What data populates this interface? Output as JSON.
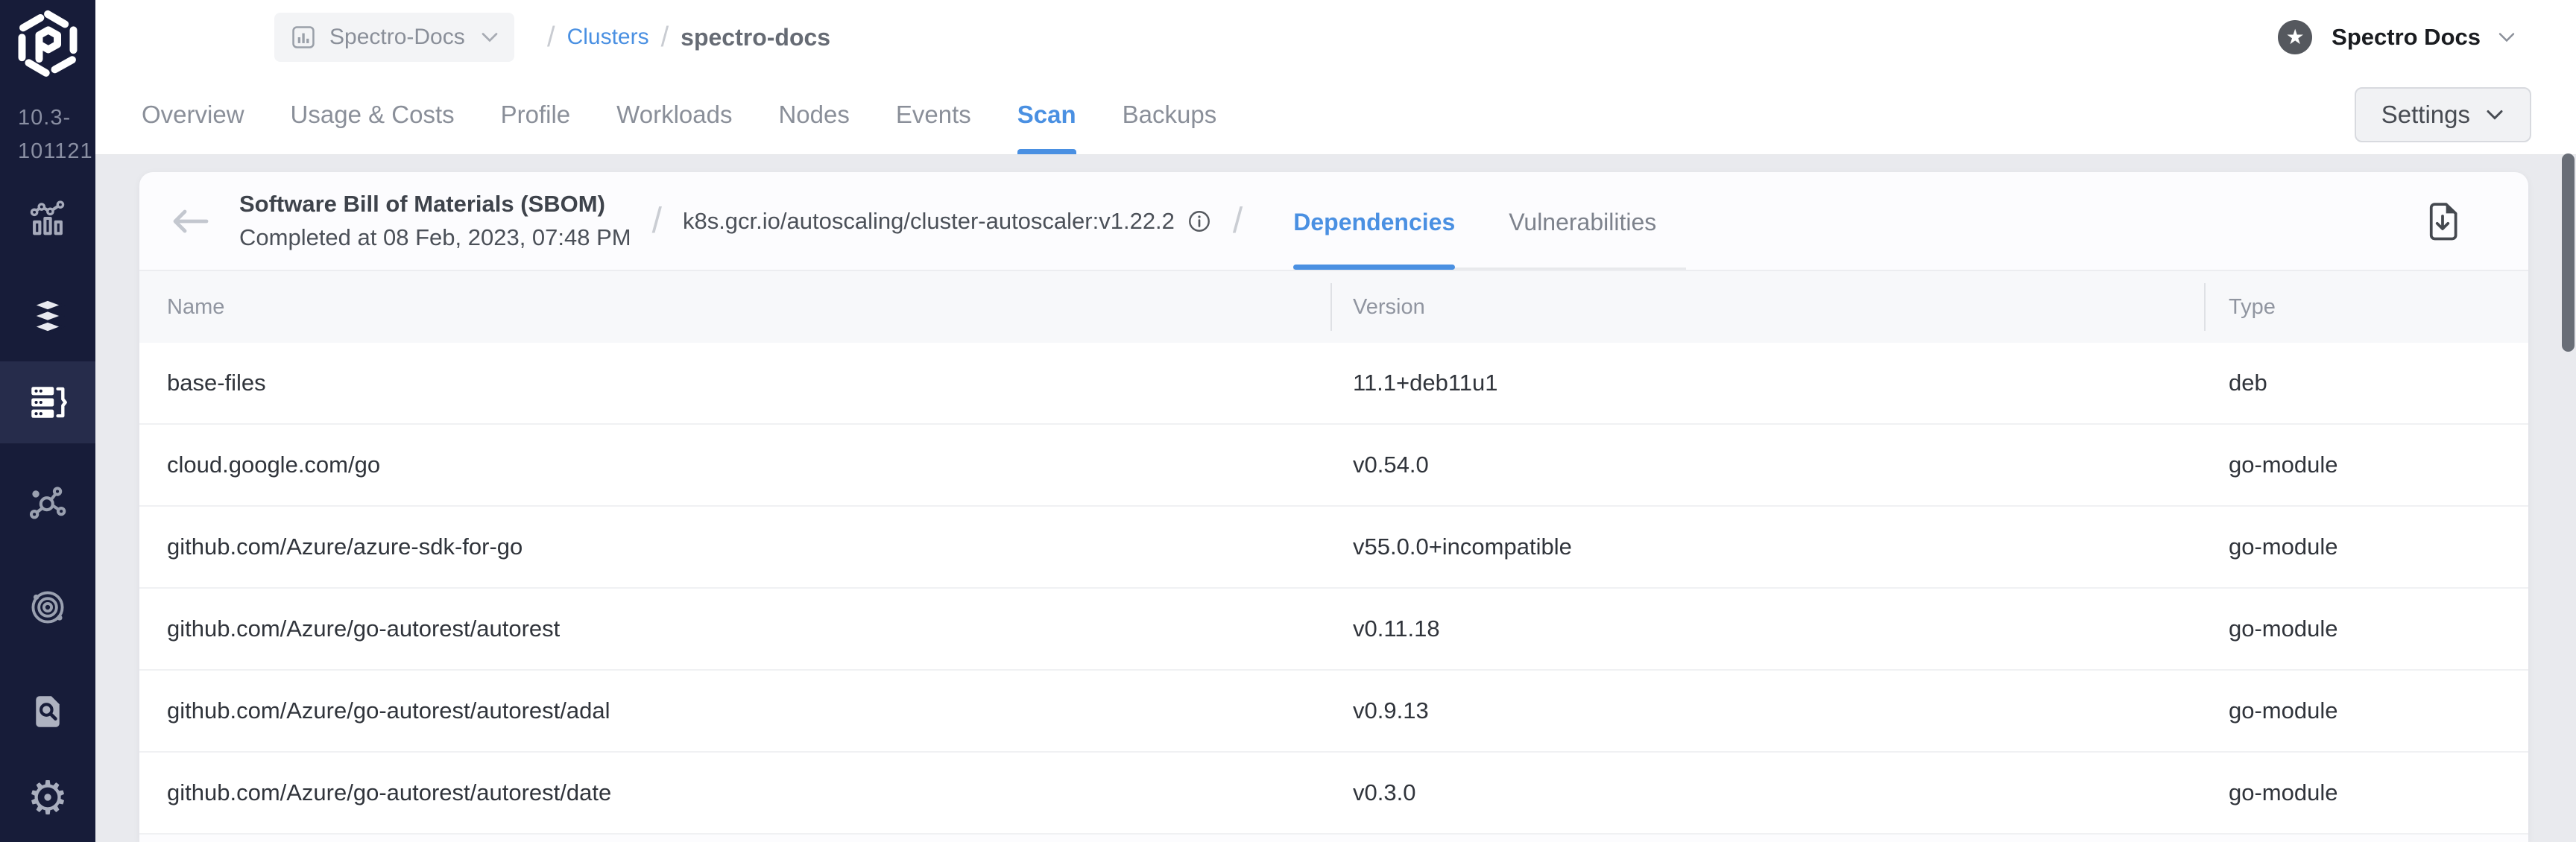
{
  "colors": {
    "accent_blue": "#4A90E2",
    "sidebar_bg": "#171C39",
    "sidebar_active_bg": "#262C4B",
    "content_bg": "#E9EAEE",
    "card_bg": "#FCFCFE",
    "table_header_bg": "#F7F8FA"
  },
  "sidebar": {
    "logo": "palette-logo",
    "version_line1": "10.3-",
    "version_line2": "101121",
    "items": [
      {
        "name": "monitoring",
        "icon": "chart-pulse-icon",
        "active": false
      },
      {
        "name": "profiles",
        "icon": "stacked-layers-icon",
        "active": false
      },
      {
        "name": "clusters",
        "icon": "server-list-icon",
        "active": true
      },
      {
        "name": "workspaces",
        "icon": "network-nodes-icon",
        "active": false
      },
      {
        "name": "registries",
        "icon": "orbit-icon",
        "active": false
      },
      {
        "name": "audit-logs",
        "icon": "document-search-icon",
        "active": false
      },
      {
        "name": "settings",
        "icon": "gear-icon",
        "active": false
      }
    ]
  },
  "topbar": {
    "project_selector": {
      "label": "Spectro-Docs",
      "icon": "bar-chart-icon",
      "chevron": "chevron-down-icon"
    },
    "breadcrumb": {
      "separator": "/",
      "link": "Clusters",
      "current": "spectro-docs"
    },
    "user_menu": {
      "label": "Spectro Docs",
      "avatar_icon": "star-icon",
      "chevron": "chevron-down-icon"
    }
  },
  "tabs": {
    "active": "Scan",
    "items": [
      {
        "label": "Overview"
      },
      {
        "label": "Usage & Costs"
      },
      {
        "label": "Profile"
      },
      {
        "label": "Workloads"
      },
      {
        "label": "Nodes"
      },
      {
        "label": "Events"
      },
      {
        "label": "Scan"
      },
      {
        "label": "Backups"
      }
    ]
  },
  "settings_button": {
    "label": "Settings"
  },
  "scan_header": {
    "title": "Software Bill of Materials (SBOM)",
    "subtitle": "Completed at 08 Feb, 2023, 07:48 PM",
    "separator": "/",
    "image_name": "k8s.gcr.io/autoscaling/cluster-autoscaler:v1.22.2",
    "active_tab": "Dependencies",
    "tabs": [
      {
        "label": "Dependencies"
      },
      {
        "label": "Vulnerabilities"
      }
    ]
  },
  "table": {
    "columns": [
      "Name",
      "Version",
      "Type"
    ],
    "rows": [
      {
        "name": "base-files",
        "version": "11.1+deb11u1",
        "type": "deb"
      },
      {
        "name": "cloud.google.com/go",
        "version": "v0.54.0",
        "type": "go-module"
      },
      {
        "name": "github.com/Azure/azure-sdk-for-go",
        "version": "v55.0.0+incompatible",
        "type": "go-module"
      },
      {
        "name": "github.com/Azure/go-autorest/autorest",
        "version": "v0.11.18",
        "type": "go-module"
      },
      {
        "name": "github.com/Azure/go-autorest/autorest/adal",
        "version": "v0.9.13",
        "type": "go-module"
      },
      {
        "name": "github.com/Azure/go-autorest/autorest/date",
        "version": "v0.3.0",
        "type": "go-module"
      }
    ]
  }
}
